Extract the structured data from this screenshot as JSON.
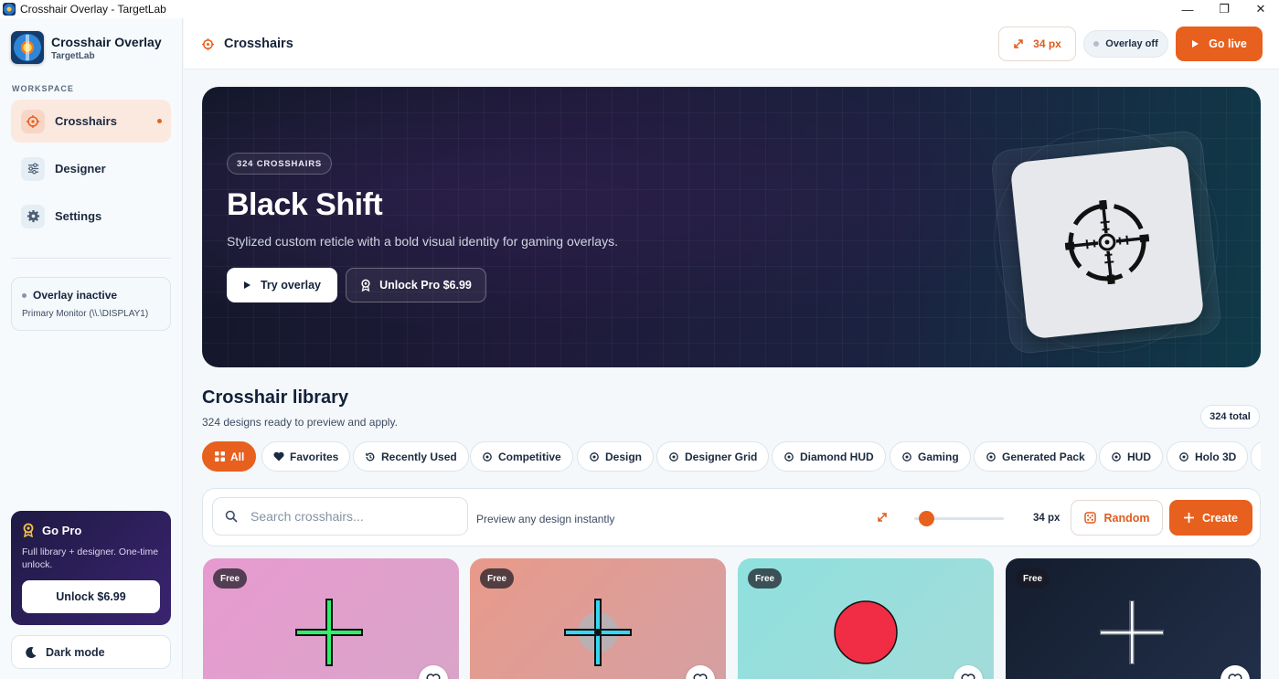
{
  "window": {
    "title": "Crosshair Overlay - TargetLab",
    "minimize": "—",
    "maximize": "❐",
    "close": "✕"
  },
  "sidebar": {
    "app_name": "Crosshair Overlay",
    "app_sub": "TargetLab",
    "section_label": "WORKSPACE",
    "items": [
      {
        "label": "Crosshairs",
        "icon": "target-icon",
        "active": true
      },
      {
        "label": "Designer",
        "icon": "sliders-icon",
        "active": false
      },
      {
        "label": "Settings",
        "icon": "gear-icon",
        "active": false
      }
    ],
    "overlay_status": {
      "title": "Overlay inactive",
      "monitor": "Primary Monitor (\\\\.\\DISPLAY1)"
    },
    "gopro": {
      "title": "Go Pro",
      "desc": "Full library + designer. One-time unlock.",
      "button": "Unlock $6.99"
    },
    "dark_mode": "Dark mode"
  },
  "header": {
    "title": "Crosshairs",
    "size_label": "34 px",
    "overlay_label": "Overlay off",
    "live_label": "Go live"
  },
  "hero": {
    "pill": "324 CROSSHAIRS",
    "title": "Black Shift",
    "description": "Stylized custom reticle with a bold visual identity for gaming overlays.",
    "try_button": "Try overlay",
    "unlock_button": "Unlock Pro $6.99"
  },
  "library": {
    "title": "Crosshair library",
    "subtitle": "324 designs ready to preview and apply.",
    "total": "324 total",
    "categories": [
      "All",
      "Favorites",
      "Recently Used",
      "Competitive",
      "Design",
      "Designer Grid",
      "Diamond HUD",
      "Gaming",
      "Generated Pack",
      "HUD",
      "Holo 3D"
    ],
    "active_category": "All"
  },
  "toolbar": {
    "search_placeholder": "Search crosshairs...",
    "hint": "Preview any design instantly",
    "size_value": "34 px",
    "size_slider_fraction": 0.06,
    "random": "Random",
    "create": "Create"
  },
  "cards": [
    {
      "badge": "Free",
      "style": "green-cross",
      "bg": "pink"
    },
    {
      "badge": "Free",
      "style": "cyan-cross-dot",
      "bg": "salmon"
    },
    {
      "badge": "Free",
      "style": "red-dot",
      "bg": "teal"
    },
    {
      "badge": "Free",
      "style": "white-glow-cross",
      "bg": "navy"
    }
  ],
  "colors": {
    "accent": "#e8601e",
    "hero_dark": "#13182a",
    "text": "#15233a"
  }
}
